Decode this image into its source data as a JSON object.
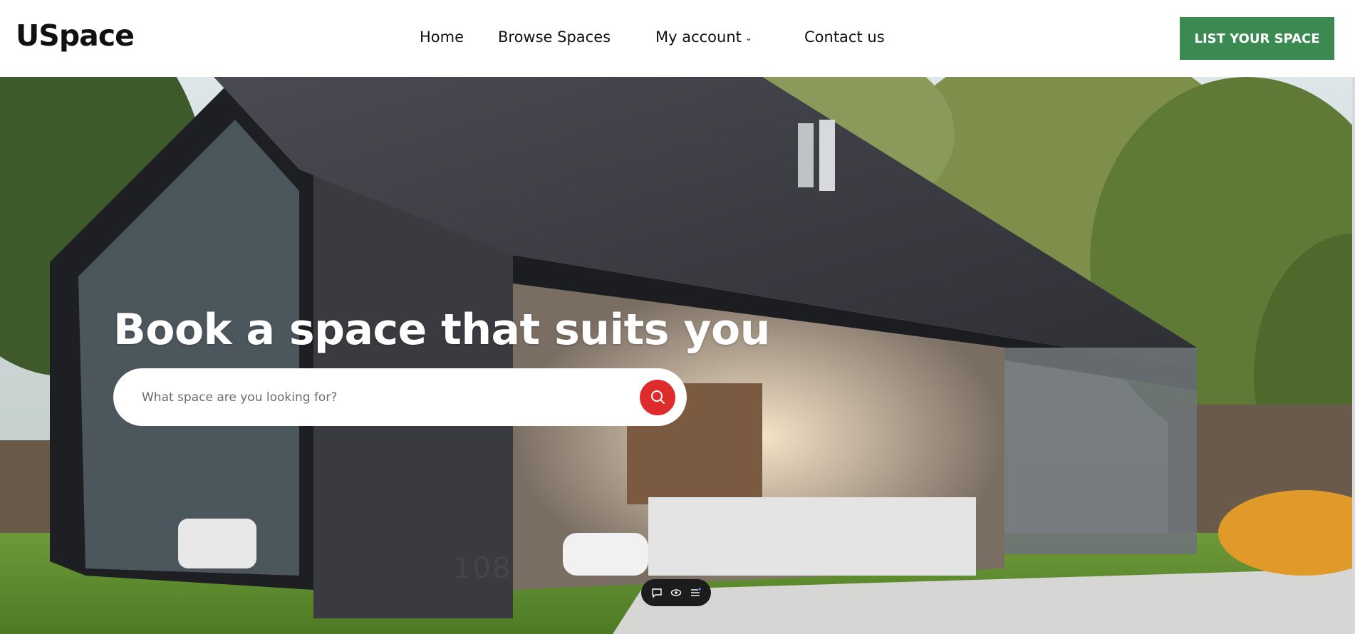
{
  "header": {
    "logo": "USpace",
    "nav": {
      "home": "Home",
      "browse": "Browse Spaces",
      "account": "My account",
      "contact": "Contact us"
    },
    "cta_label": "LIST YOUR SPACE",
    "cta_color": "#3b8a52"
  },
  "hero": {
    "headline": "Book a space that suits you",
    "search": {
      "placeholder": "What space are you looking for?",
      "button_color": "#de2b2b",
      "button_icon": "search-icon"
    },
    "house_number": "108",
    "toolbar_icons": [
      "comment-icon",
      "eye-icon",
      "menu-list-icon"
    ]
  }
}
